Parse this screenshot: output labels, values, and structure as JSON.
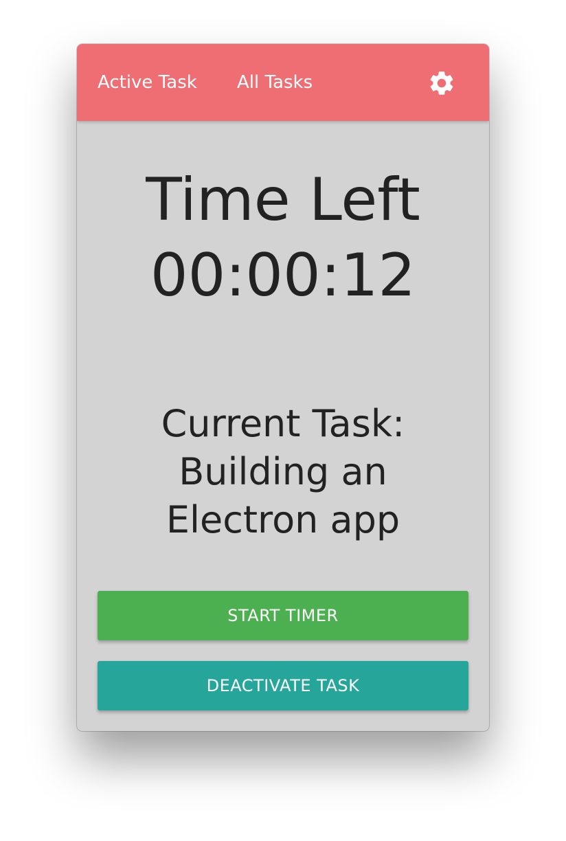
{
  "navbar": {
    "links": [
      {
        "label": "Active Task"
      },
      {
        "label": "All Tasks"
      }
    ],
    "settings_icon": "gear-icon",
    "color": "#ee6e73"
  },
  "timer": {
    "title": "Time Left",
    "value": "00:00:12"
  },
  "task": {
    "label": "Current Task:",
    "name": "Building an Electron app"
  },
  "buttons": {
    "start": {
      "label": "START TIMER",
      "color": "#4caf50"
    },
    "deactivate": {
      "label": "DEACTIVATE TASK",
      "color": "#26a69a"
    }
  },
  "colors": {
    "background": "#d3d3d3",
    "text": "#222222"
  }
}
